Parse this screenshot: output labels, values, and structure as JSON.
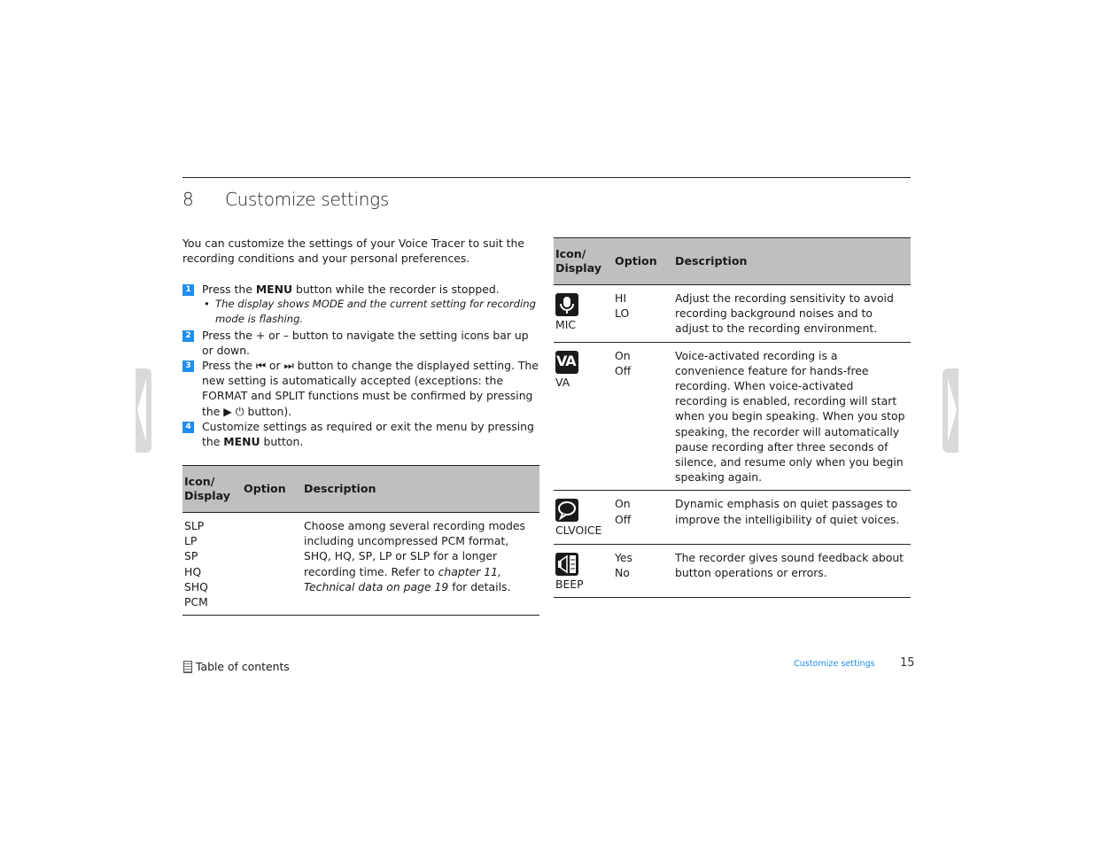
{
  "chapter": {
    "number": "8",
    "title": "Customize settings"
  },
  "intro": "You can customize the settings of your Voice Tracer to suit the recording conditions and your personal preferences.",
  "steps": [
    {
      "num": "1",
      "pre": "Press the ",
      "bold": "MENU",
      "post": " button while the recorder is stopped.",
      "sub": "The display shows MODE and the current setting for recording mode is flashing."
    },
    {
      "num": "2",
      "text": "Press the + or – button to navigate the setting icons bar up or down."
    },
    {
      "num": "3",
      "text": "Press the ⏮ or ⏭ button to change the displayed setting. The new setting is automatically accepted (exceptions: the FORMAT and SPLIT functions must be confirmed by pressing the ▶ ⏻ button)."
    },
    {
      "num": "4",
      "pre": "Customize settings as required or exit the menu by pressing the ",
      "bold": "MENU",
      "post": " button."
    }
  ],
  "table_headers": {
    "icon": "Icon/ Display",
    "option": "Option",
    "description": "Description"
  },
  "table1": {
    "rows": [
      {
        "displays": [
          "SLP",
          "LP",
          "SP",
          "HQ",
          "SHQ",
          "PCM"
        ],
        "options": [],
        "description": "Choose among several recording modes including uncompressed PCM format, SHQ, HQ, SP, LP or SLP for a longer recording time. Refer to ",
        "description_ref": "chapter 11, Technical data on page 19",
        "description_tail": " for details."
      }
    ]
  },
  "table2": {
    "rows": [
      {
        "icon": "microphone-icon",
        "label": "MIC",
        "options": [
          "HI",
          "LO"
        ],
        "description": "Adjust the recording sensitivity to avoid recording background noises and to adjust to the recording environment."
      },
      {
        "icon": "va-icon",
        "icon_text": "VA",
        "label": "VA",
        "options": [
          "On",
          "Off"
        ],
        "description": "Voice-activated recording is a convenience feature for hands-free recording. When voice-activated recording is enabled, recording will start when you begin speaking. When you stop speaking, the recorder will automatically pause recording after three seconds of silence, and resume only when you begin speaking again."
      },
      {
        "icon": "speech-bubble-icon",
        "label": "CLVOICE",
        "options": [
          "On",
          "Off"
        ],
        "description": "Dynamic emphasis on quiet passages to improve the intelligibility of quiet voices."
      },
      {
        "icon": "speaker-beep-icon",
        "label": "BEEP",
        "options": [
          "Yes",
          "No"
        ],
        "description": "The recorder gives sound feedback about button operations or errors."
      }
    ]
  },
  "footer": {
    "toc_label": "Table of contents",
    "section": "Customize settings",
    "page": "15"
  },
  "colors": {
    "accent": "#1e8ef0",
    "header_bg": "#bfbfbf",
    "side_tab": "#d9d9d9"
  }
}
